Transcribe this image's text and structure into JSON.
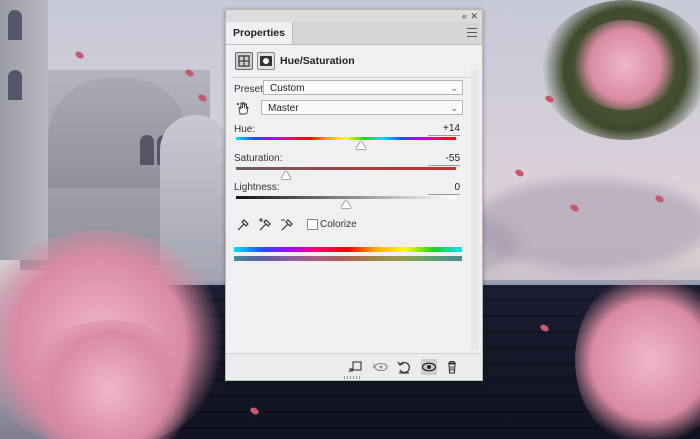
{
  "panel": {
    "tab_label": "Properties",
    "collapse_glyph": "«",
    "close_glyph": "✕",
    "adjustment_title": "Hue/Saturation",
    "preset": {
      "label": "Preset:",
      "value": "Custom"
    },
    "channel": {
      "value": "Master"
    },
    "hue": {
      "label": "Hue:",
      "value": "+14",
      "fraction": 0.57
    },
    "saturation": {
      "label": "Saturation:",
      "value": "-55",
      "fraction": 0.225
    },
    "lightness": {
      "label": "Lightness:",
      "value": "0",
      "fraction": 0.5
    },
    "colorize": {
      "label": "Colorize",
      "checked": false
    },
    "icons": {
      "adjustment_icon": "hue-saturation-icon",
      "mask_icon": "layer-mask-icon",
      "targeted_adjust": "hand-pointer-icon",
      "eyedropper": "eyedropper-icon",
      "eyedropper_add": "eyedropper-plus-icon",
      "eyedropper_subtract": "eyedropper-minus-icon",
      "clip_to_layer": "clip-to-layer-icon",
      "view_previous": "view-previous-icon",
      "reset": "reset-icon",
      "visibility": "eye-icon",
      "delete": "trash-icon"
    }
  },
  "colors": {
    "panel_bg": "#f0f0f0",
    "saturation_track": "#c7322b",
    "lightness_track_from": "#111111",
    "lightness_track_to": "#ffffff"
  }
}
